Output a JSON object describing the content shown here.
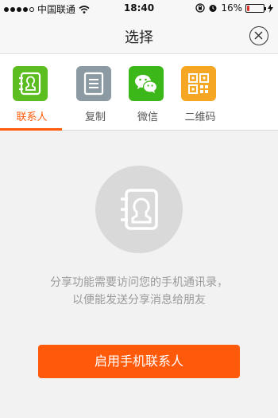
{
  "status_bar": {
    "carrier": "中国联通",
    "time": "18:40",
    "battery_percent": "16%",
    "battery_level": 0.16
  },
  "header": {
    "title": "选择"
  },
  "tabs": [
    {
      "label": "联系人",
      "icon": "contacts-icon",
      "color": "#5bbd1f",
      "active": true
    },
    {
      "label": "复制",
      "icon": "copy-icon",
      "color": "#8b9aa3",
      "active": false
    },
    {
      "label": "微信",
      "icon": "wechat-icon",
      "color": "#3cb71a",
      "active": false
    },
    {
      "label": "二维码",
      "icon": "qrcode-icon",
      "color": "#f5a623",
      "active": false
    }
  ],
  "main": {
    "message_line1": "分享功能需要访问您的手机通讯录，",
    "message_line2": "以便能发送分享消息给朋友",
    "button_label": "启用手机联系人"
  },
  "colors": {
    "accent": "#ff5a0a",
    "background": "#f2f2f2"
  }
}
